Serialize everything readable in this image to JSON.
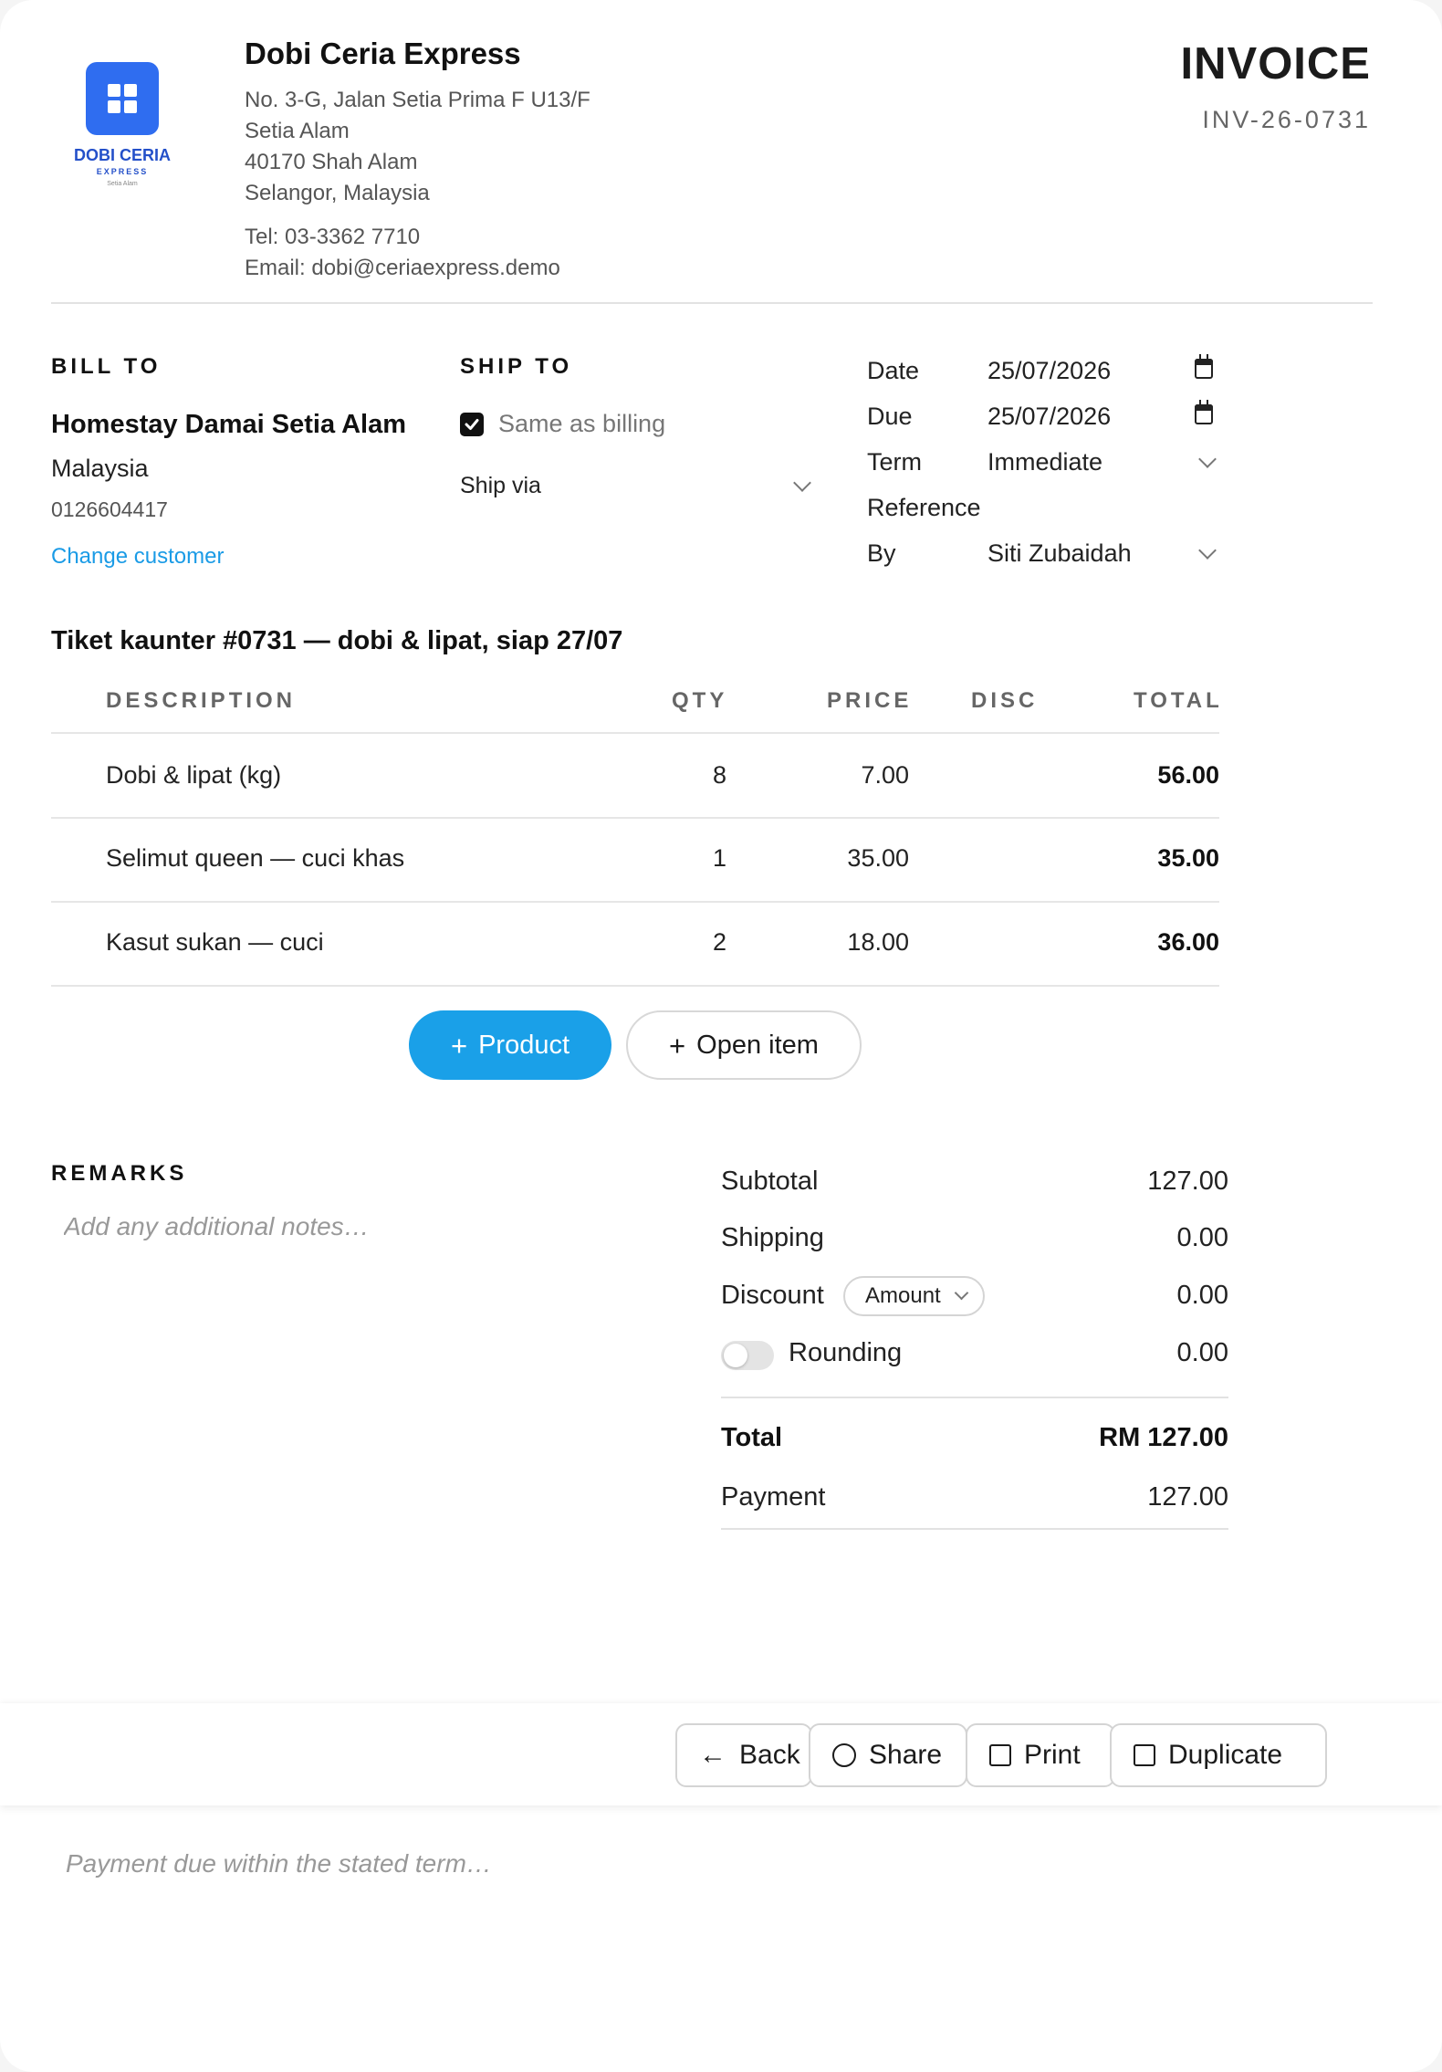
{
  "company": {
    "logo_name": "DOBI CERIA",
    "logo_sub": "EXPRESS",
    "logo_location": "Setia Alam",
    "name": "Dobi Ceria Express",
    "address": [
      "No. 3-G, Jalan Setia Prima F U13/F",
      "Setia Alam",
      "40170 Shah Alam",
      "Selangor, Malaysia"
    ],
    "tel": "Tel: 03-3362 7710",
    "email": "Email: dobi@ceriaexpress.demo"
  },
  "document": {
    "title": "INVOICE",
    "number": "INV-26-0731"
  },
  "bill_to": {
    "label": "BILL TO",
    "name": "Homestay Damai Setia Alam",
    "country": "Malaysia",
    "phone": "0126604417",
    "change_link": "Change customer"
  },
  "ship_to": {
    "label": "SHIP TO",
    "same_as_billing": "Same as billing",
    "same_checked": true,
    "ship_via_placeholder": "Ship via"
  },
  "meta": {
    "date_label": "Date",
    "date_value": "25/07/2026",
    "due_label": "Due",
    "due_value": "25/07/2026",
    "term_label": "Term",
    "term_value": "Immediate",
    "reference_label": "Reference",
    "reference_value": "",
    "by_label": "By",
    "by_value": "Siti Zubaidah"
  },
  "items": {
    "title": "Tiket kaunter #0731 — dobi & lipat, siap 27/07",
    "headers": {
      "description": "DESCRIPTION",
      "qty": "QTY",
      "price": "PRICE",
      "disc": "DISC",
      "total": "TOTAL"
    },
    "rows": [
      {
        "description": "Dobi & lipat (kg)",
        "qty": "8",
        "price": "7.00",
        "disc": "",
        "total": "56.00"
      },
      {
        "description": "Selimut queen — cuci khas",
        "qty": "1",
        "price": "35.00",
        "disc": "",
        "total": "35.00"
      },
      {
        "description": "Kasut sukan — cuci",
        "qty": "2",
        "price": "18.00",
        "disc": "",
        "total": "36.00"
      }
    ],
    "add_product": "Product",
    "add_open_item": "Open item"
  },
  "remarks": {
    "label": "REMARKS",
    "placeholder": "Add any additional notes…"
  },
  "summary": {
    "subtotal_label": "Subtotal",
    "subtotal_value": "127.00",
    "shipping_label": "Shipping",
    "shipping_value": "0.00",
    "discount_label": "Discount",
    "discount_type": "Amount",
    "discount_value": "0.00",
    "rounding_label": "Rounding",
    "rounding_value": "0.00",
    "rounding_on": false,
    "total_label": "Total",
    "total_value": "RM 127.00",
    "payment_label": "Payment",
    "payment_value": "127.00"
  },
  "footer": {
    "back": "Back",
    "share": "Share",
    "print": "Print",
    "duplicate": "Duplicate",
    "note_placeholder": "Payment due within the stated term…"
  },
  "colors": {
    "accent": "#1aa0e8",
    "logo": "#2f6df0",
    "link": "#1a9be6"
  }
}
